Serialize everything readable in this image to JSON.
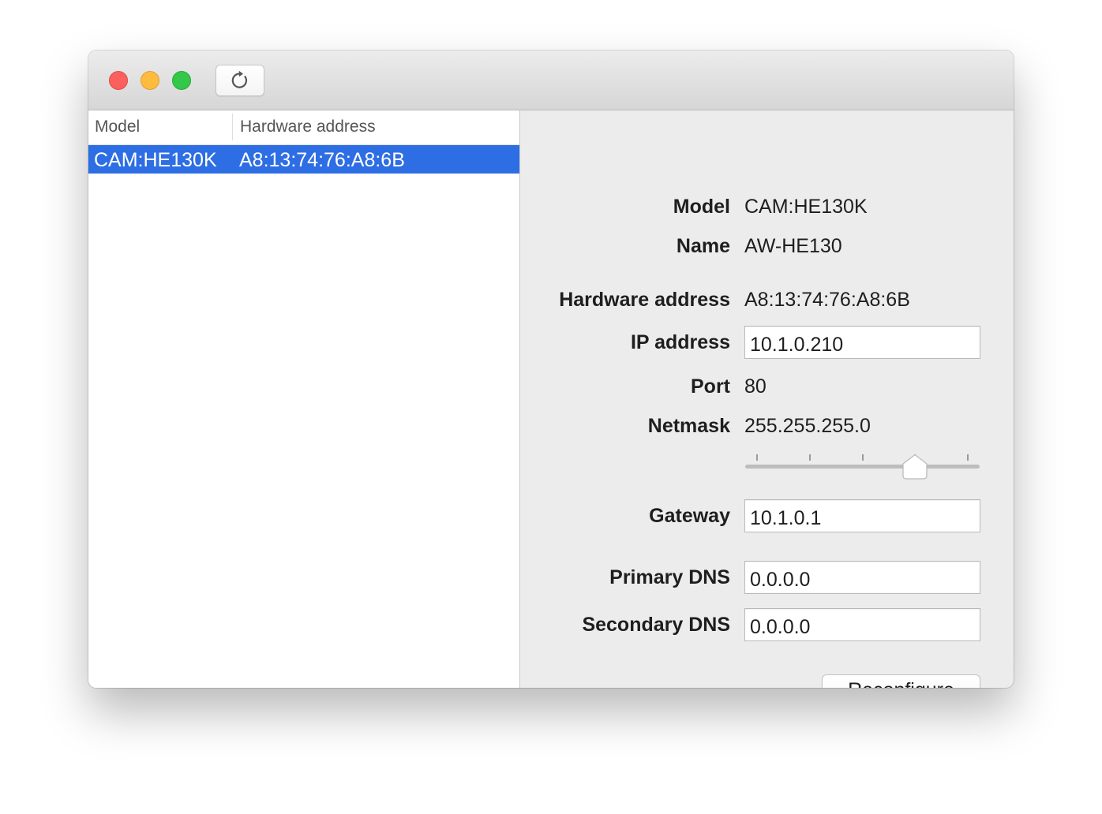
{
  "toolbar": {
    "refresh_icon": "refresh-icon"
  },
  "list": {
    "columns": [
      "Model",
      "Hardware address"
    ],
    "rows": [
      {
        "model": "CAM:HE130K",
        "hardware_address": "A8:13:74:76:A8:6B",
        "selected": true
      }
    ]
  },
  "details": {
    "model_label": "Model",
    "model_value": "CAM:HE130K",
    "name_label": "Name",
    "name_value": "AW-HE130",
    "hw_label": "Hardware address",
    "hw_value": "A8:13:74:76:A8:6B",
    "ip_label": "IP address",
    "ip_value": "10.1.0.210",
    "port_label": "Port",
    "port_value": "80",
    "netmask_label": "Netmask",
    "netmask_value": "255.255.255.0",
    "netmask_slider": {
      "ticks": 5,
      "selected_tick_index": 3
    },
    "gateway_label": "Gateway",
    "gateway_value": "10.1.0.1",
    "primary_dns_label": "Primary DNS",
    "primary_dns_value": "0.0.0.0",
    "secondary_dns_label": "Secondary DNS",
    "secondary_dns_value": "0.0.0.0",
    "reconfigure_label": "Reconfigure"
  },
  "colors": {
    "selection": "#2e6ee4",
    "close": "#fc605c",
    "minimize": "#fdbc40",
    "maximize": "#34c84a"
  }
}
